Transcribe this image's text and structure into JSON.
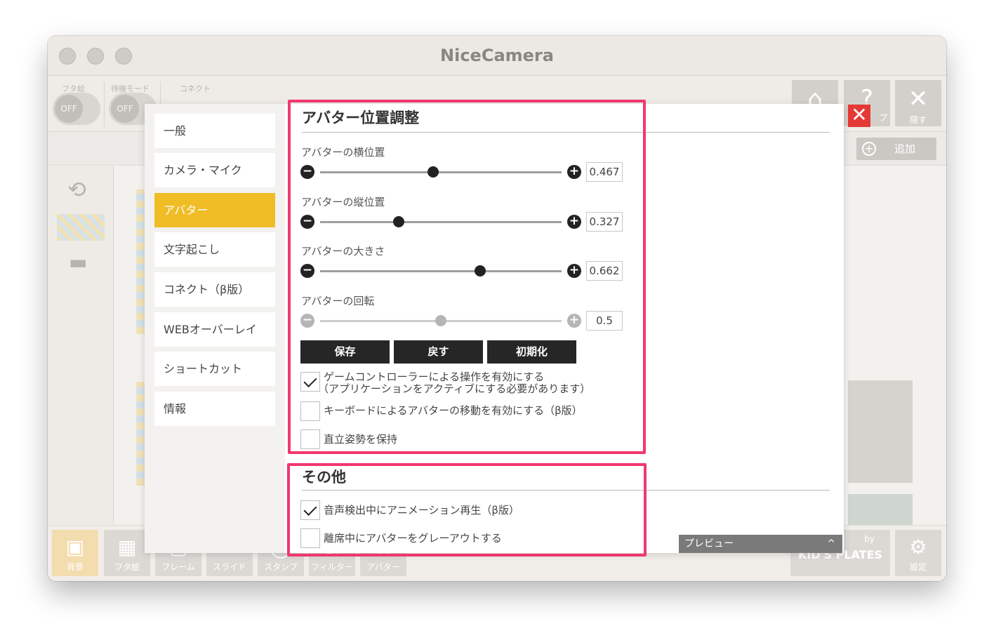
{
  "window": {
    "title": "NiceCamera"
  },
  "toolbar": {
    "futae_label": "フタ絵",
    "standby_label": "待機モード",
    "connect_label": "コネクト",
    "toggle_off": "OFF",
    "toggle_off2": "OFF",
    "help_label": "プ",
    "hide_label": "隠す",
    "add_label": "追加"
  },
  "bottom_bar": {
    "items": [
      "背景",
      "フタ絵",
      "フレーム",
      "スライド",
      "スタンプ",
      "フィルター",
      "アバター"
    ],
    "by_label": "by",
    "brand_label": "KID'S PLATES",
    "settings_label": "設定"
  },
  "menu": {
    "items": [
      "一般",
      "カメラ・マイク",
      "アバター",
      "文字起こし",
      "コネクト（β版）",
      "WEBオーバーレイ",
      "ショートカット",
      "情報"
    ],
    "active_index": 2
  },
  "avatar_section": {
    "title": "アバター位置調整",
    "sliders": [
      {
        "label": "アバターの横位置",
        "value": "0.467",
        "fraction": 0.467,
        "enabled": true
      },
      {
        "label": "アバターの縦位置",
        "value": "0.327",
        "fraction": 0.327,
        "enabled": true
      },
      {
        "label": "アバターの大きさ",
        "value": "0.662",
        "fraction": 0.662,
        "enabled": true
      },
      {
        "label": "アバターの回転",
        "value": "0.5",
        "fraction": 0.5,
        "enabled": false
      }
    ],
    "buttons": {
      "save": "保存",
      "revert": "戻す",
      "reset": "初期化"
    },
    "checkboxes": [
      {
        "line1": "ゲームコントローラーによる操作を有効にする",
        "line2": "（アプリケーションをアクティブにする必要があります）",
        "checked": true
      },
      {
        "line1": "キーボードによるアバターの移動を有効にする（β版）",
        "line2": "",
        "checked": false
      },
      {
        "line1": "直立姿勢を保持",
        "line2": "",
        "checked": false
      }
    ]
  },
  "other_section": {
    "title": "その他",
    "checkboxes": [
      {
        "label": "音声検出中にアニメーション再生（β版）",
        "checked": true
      },
      {
        "label": "離席中にアバターをグレーアウトする",
        "checked": false
      }
    ]
  },
  "preview": {
    "label": "プレビュー",
    "caret": "^"
  },
  "colors": {
    "accent": "#f0bd27",
    "highlight": "#f0386f",
    "close": "#e53935"
  }
}
